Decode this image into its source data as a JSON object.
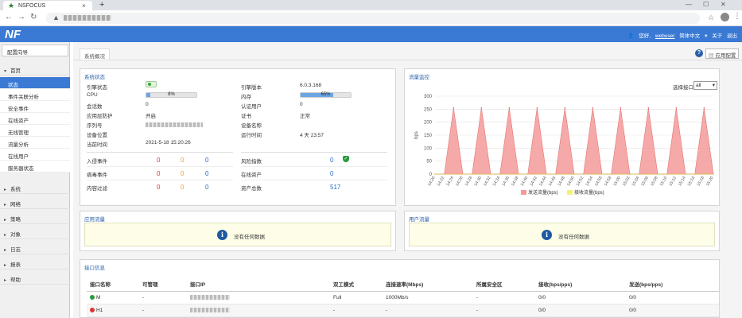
{
  "browser": {
    "tab_title": "NSFOCUS",
    "tab_close": "×",
    "new_tab": "+",
    "min": "—",
    "max": "☐",
    "close": "✕"
  },
  "app": {
    "logo": "NF",
    "user_greeting": "您好,",
    "user_name": "webuser",
    "lang": "简体中文",
    "about": "关于",
    "exit": "退出"
  },
  "sidebar": {
    "wizard": "配置向导",
    "home": "首页",
    "sub_items": [
      "状态",
      "事件关联分析",
      "安全事件",
      "在线资产",
      "无线管理",
      "流量分析",
      "在线用户",
      "服务器状态"
    ],
    "categories": [
      "系统",
      "网络",
      "策略",
      "对象",
      "日志",
      "报表",
      "帮助"
    ]
  },
  "content": {
    "breadcrumb": "系统概况",
    "app_config": "应用配置"
  },
  "system_status": {
    "title": "系统状态",
    "left": [
      {
        "label": "引擎状态",
        "value": ""
      },
      {
        "label": "CPU",
        "value": ""
      },
      {
        "label": "会话数",
        "value": "0"
      },
      {
        "label": "应用层防护",
        "value": "开启"
      },
      {
        "label": "序列号",
        "value": ""
      },
      {
        "label": "设备位置",
        "value": ""
      },
      {
        "label": "当前时间",
        "value": "2021-5-18 15:20:26"
      }
    ],
    "cpu_percent": 8,
    "cpu_text": "8%",
    "right": [
      {
        "label": "引擎版本",
        "value": "6.0.3.168"
      },
      {
        "label": "内存",
        "value": ""
      },
      {
        "label": "认证用户",
        "value": "0"
      },
      {
        "label": "证书",
        "value": "正常"
      },
      {
        "label": "设备名称",
        "value": ""
      },
      {
        "label": "运行时间",
        "value": "4 天 23:57"
      }
    ],
    "mem_percent": 65,
    "mem_text": "65%",
    "events": [
      {
        "label": "入侵事件",
        "v1": "0",
        "v2": "0",
        "v3": "0"
      },
      {
        "label": "病毒事件",
        "v1": "0",
        "v2": "0",
        "v3": "0"
      },
      {
        "label": "内容过滤",
        "v1": "0",
        "v2": "0",
        "v3": "0"
      }
    ],
    "risk": [
      {
        "label": "风险指数",
        "value": "0"
      },
      {
        "label": "在线资产",
        "value": "0"
      },
      {
        "label": "资产总数",
        "value": "517"
      }
    ]
  },
  "traffic": {
    "title": "流量监控",
    "select_label": "选择接口",
    "select_value": "all",
    "ylabel": "bps",
    "legend_send": "发送流量(bps)",
    "legend_recv": "接收流量(bps)",
    "color_send": "#f49a9a",
    "color_recv": "#f5f07a"
  },
  "chart_data": {
    "type": "area",
    "title": "",
    "xlabel": "",
    "ylabel": "bps",
    "ylim": [
      0,
      300
    ],
    "yticks": [
      0,
      50,
      100,
      150,
      200,
      250,
      300
    ],
    "x": [
      "14:20",
      "14:22",
      "14:24",
      "14:26",
      "14:28",
      "14:30",
      "14:32",
      "14:34",
      "14:36",
      "14:38",
      "14:40",
      "14:42",
      "14:44",
      "14:46",
      "14:48",
      "14:50",
      "14:52",
      "14:54",
      "14:56",
      "14:58",
      "15:00",
      "15:02",
      "15:04",
      "15:06",
      "15:08",
      "15:10",
      "15:12",
      "15:14",
      "15:16",
      "15:18",
      "15:20"
    ],
    "series": [
      {
        "name": "发送流量(bps)",
        "values": [
          0,
          0,
          255,
          0,
          0,
          255,
          0,
          0,
          255,
          0,
          0,
          255,
          0,
          0,
          255,
          0,
          0,
          255,
          0,
          0,
          255,
          0,
          0,
          255,
          0,
          0,
          255,
          0,
          0,
          255,
          0
        ]
      },
      {
        "name": "接收流量(bps)",
        "values": [
          0,
          0,
          0,
          0,
          0,
          0,
          0,
          0,
          0,
          0,
          0,
          0,
          0,
          0,
          0,
          0,
          0,
          0,
          0,
          0,
          0,
          0,
          0,
          0,
          0,
          0,
          0,
          0,
          0,
          0,
          0
        ]
      }
    ]
  },
  "app_traffic": {
    "title": "应用流量",
    "nodata": "没有任何数据"
  },
  "user_traffic": {
    "title": "用户流量",
    "nodata": "没有任何数据"
  },
  "interfaces": {
    "title": "接口信息",
    "headers": [
      "接口名称",
      "可管理",
      "接口IP",
      "双工模式",
      "连接速率(Mbps)",
      "所属安全区",
      "接收(bps/pps)",
      "发送(bps/pps)"
    ],
    "rows": [
      {
        "name": "M",
        "status_color": "#2a9a3a",
        "manage": "-",
        "duplex": "Full",
        "speed": "1000Mb/s",
        "zone": "-",
        "recv": "0/0",
        "send": "0/0"
      },
      {
        "name": "H1",
        "status_color": "#d33",
        "manage": "-",
        "duplex": "-",
        "speed": "-",
        "zone": "-",
        "recv": "0/0",
        "send": "0/0"
      }
    ]
  }
}
